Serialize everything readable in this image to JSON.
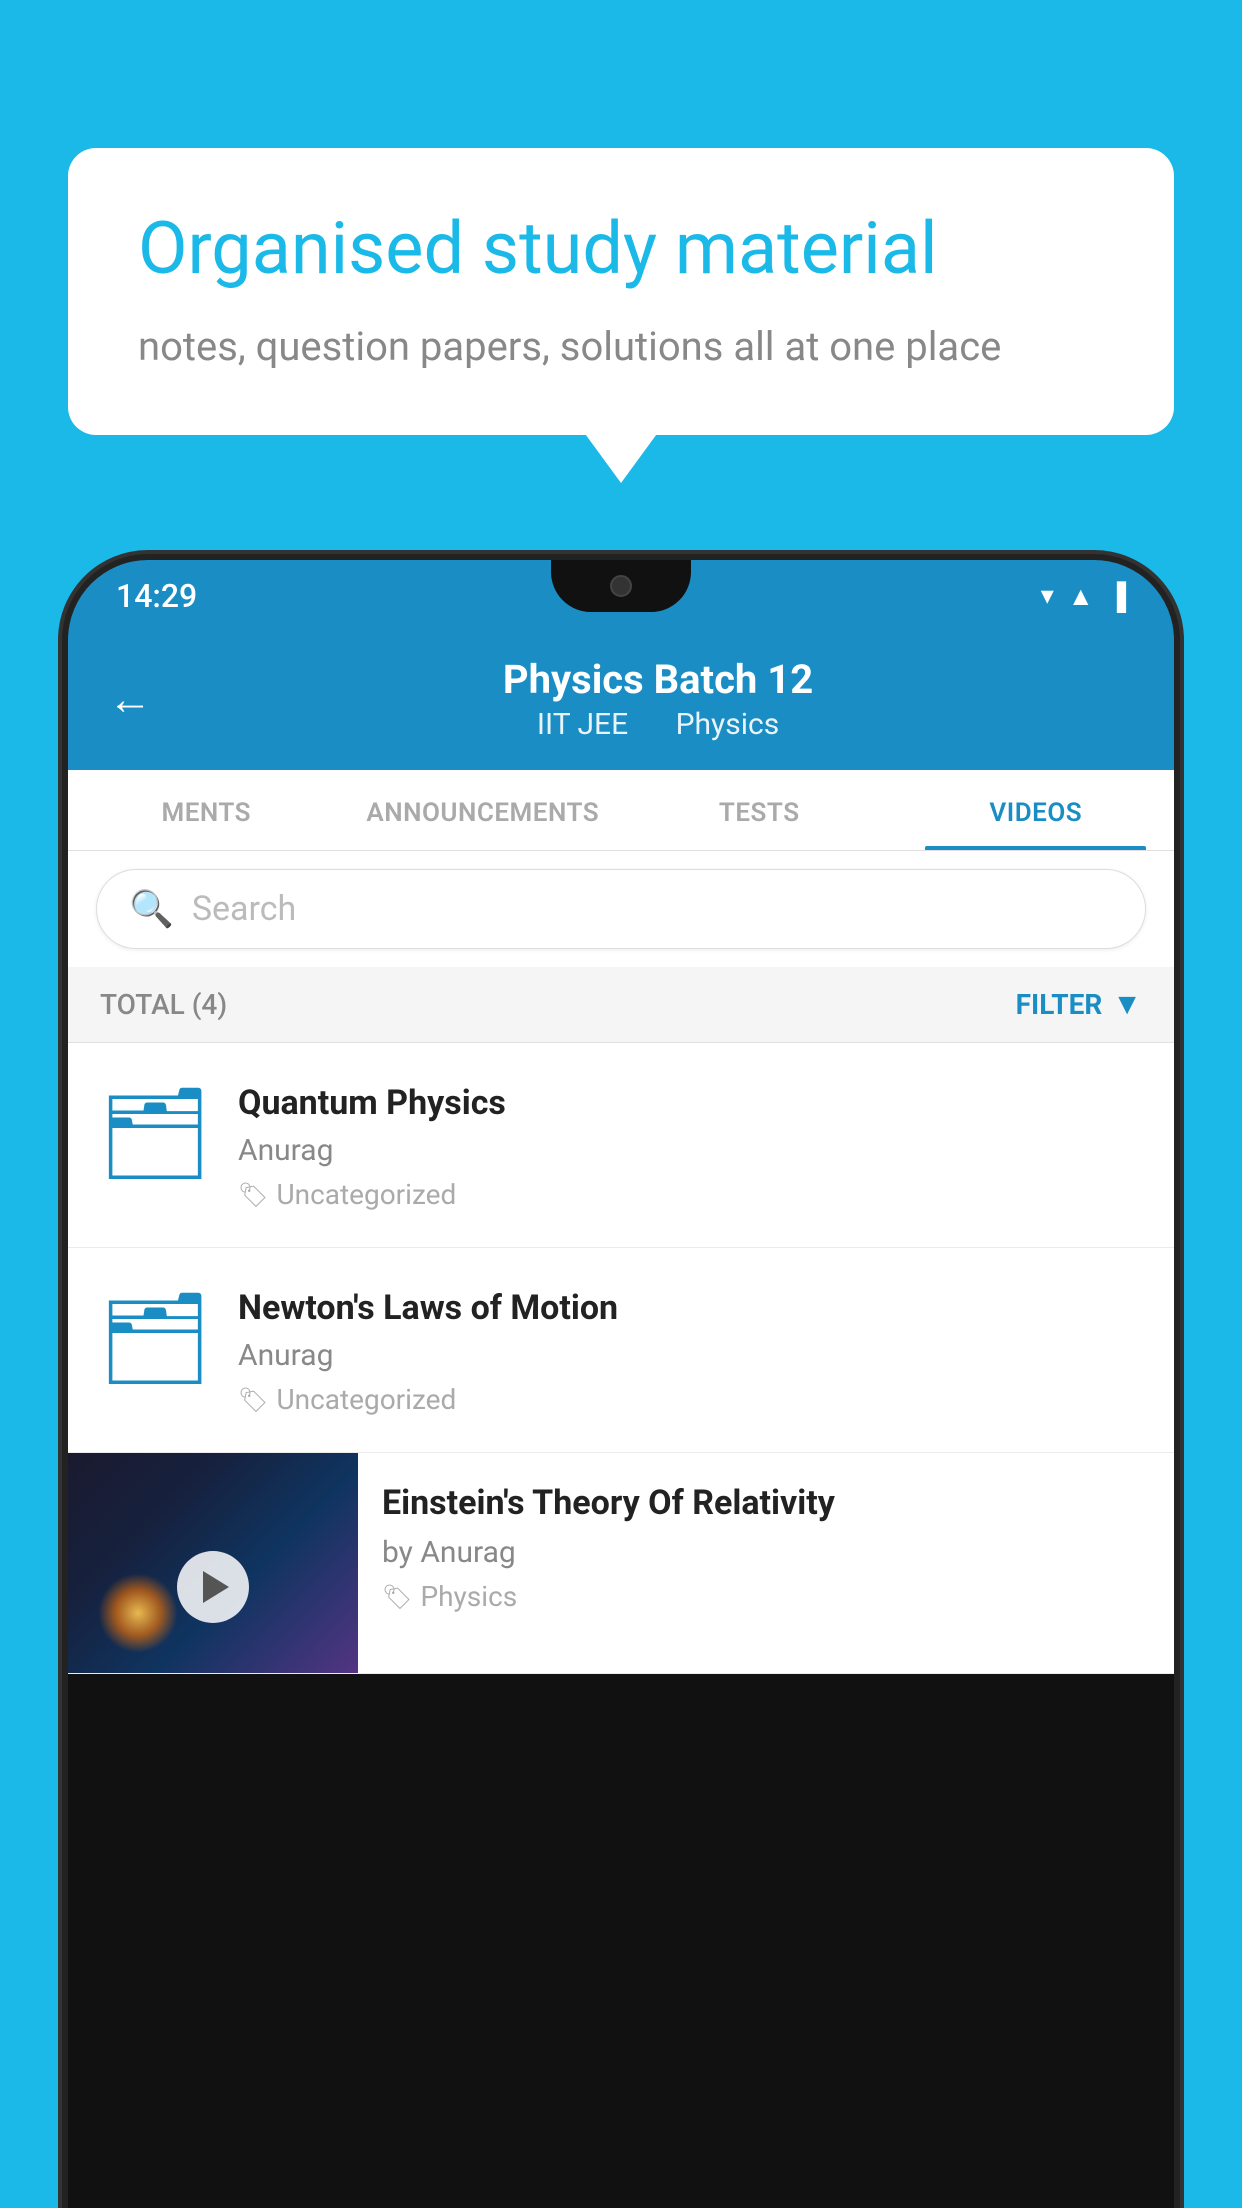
{
  "background_color": "#1ab9e8",
  "speech_bubble": {
    "title": "Organised study material",
    "subtitle": "notes, question papers, solutions all at one place"
  },
  "status_bar": {
    "time": "14:29",
    "wifi_icon": "▼",
    "signal_icon": "▲",
    "battery_icon": "▋"
  },
  "header": {
    "title": "Physics Batch 12",
    "subtitle_part1": "IIT JEE",
    "subtitle_part2": "Physics",
    "back_label": "←"
  },
  "tabs": [
    {
      "label": "MENTS",
      "active": false
    },
    {
      "label": "ANNOUNCEMENTS",
      "active": false
    },
    {
      "label": "TESTS",
      "active": false
    },
    {
      "label": "VIDEOS",
      "active": true
    }
  ],
  "search": {
    "placeholder": "Search"
  },
  "filter_bar": {
    "total_label": "TOTAL (4)",
    "filter_label": "FILTER"
  },
  "videos": [
    {
      "id": "quantum",
      "title": "Quantum Physics",
      "author": "Anurag",
      "tag": "Uncategorized",
      "has_thumbnail": false
    },
    {
      "id": "newton",
      "title": "Newton's Laws of Motion",
      "author": "Anurag",
      "tag": "Uncategorized",
      "has_thumbnail": false
    },
    {
      "id": "einstein",
      "title": "Einstein's Theory Of Relativity",
      "author": "by Anurag",
      "tag": "Physics",
      "has_thumbnail": true
    }
  ]
}
